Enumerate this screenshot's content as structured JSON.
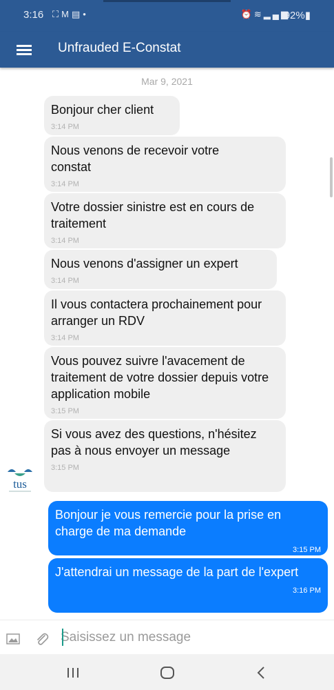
{
  "status_bar": {
    "time": "3:16",
    "left_icons": [
      "screenshot-icon",
      "gmail-icon",
      "message-icon",
      "dot-icon"
    ],
    "right_icons": [
      "alarm-icon",
      "wifi-icon",
      "signal-icon"
    ],
    "battery_text": "92%"
  },
  "app_bar": {
    "title": "Unfrauded E-Constat"
  },
  "chat": {
    "date": "Mar 9, 2021",
    "incoming": [
      {
        "text": "Bonjour cher client",
        "time": "3:14 PM"
      },
      {
        "text": "Nous venons de recevoir votre constat",
        "time": "3:14 PM"
      },
      {
        "text": "Votre dossier sinistre est en cours de traitement",
        "time": "3:14 PM"
      },
      {
        "text": "Nous venons d'assigner un expert",
        "time": "3:14 PM"
      },
      {
        "text": "Il vous contactera prochainement pour arranger un RDV",
        "time": "3:14 PM"
      },
      {
        "text": "Vous pouvez suivre l'avacement de traitement de votre dossier depuis votre application mobile",
        "time": "3:15 PM"
      },
      {
        "text": "Si vous avez des questions, n'hésitez pas à nous envoyer un message",
        "time": "3:15 PM"
      }
    ],
    "outgoing": [
      {
        "text": "Bonjour je vous remercie pour la prise en charge de ma demande",
        "time": "3:15 PM"
      },
      {
        "text": "J'attendrai un message de la part de l'expert",
        "time": "3:16 PM"
      }
    ],
    "avatar_text": "tus"
  },
  "composer": {
    "placeholder": "Saisissez un message"
  },
  "colors": {
    "app_bar": "#2c5a94",
    "incoming_bubble": "#efefef",
    "outgoing_bubble": "#0b7dff"
  }
}
